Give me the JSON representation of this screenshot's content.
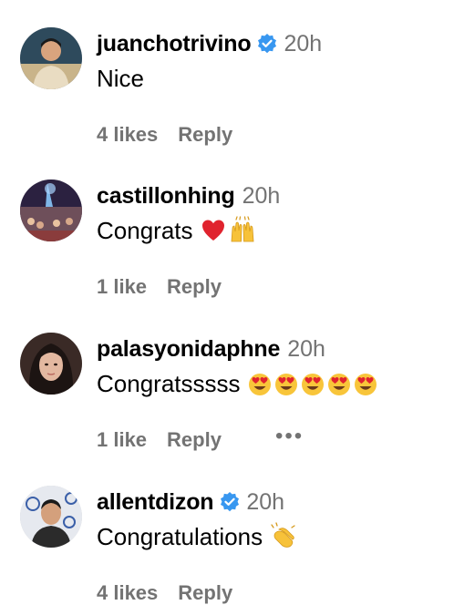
{
  "comments": [
    {
      "username": "juanchotrivino",
      "verified": true,
      "time": "20h",
      "text": "Nice",
      "emojis": [],
      "likes": "4 likes",
      "reply": "Reply",
      "more": ""
    },
    {
      "username": "castillonhing",
      "verified": false,
      "time": "20h",
      "text": "Congrats",
      "emojis": [
        "red-heart-emoji",
        "raising-hands-emoji"
      ],
      "likes": "1 like",
      "reply": "Reply",
      "more": ""
    },
    {
      "username": "palasyonidaphne",
      "verified": false,
      "time": "20h",
      "text": "Congratsssss",
      "emojis": [
        "heart-eyes-emoji",
        "heart-eyes-emoji",
        "heart-eyes-emoji",
        "heart-eyes-emoji",
        "heart-eyes-emoji"
      ],
      "likes": "1 like",
      "reply": "Reply",
      "more": "•••"
    },
    {
      "username": "allentdizon",
      "verified": true,
      "time": "20h",
      "text": "Congratulations",
      "emojis": [
        "clapping-hands-emoji"
      ],
      "likes": "4 likes",
      "reply": "Reply",
      "more": ""
    }
  ],
  "colors": {
    "verified": "#3897f0",
    "secondary_text": "#737373"
  }
}
